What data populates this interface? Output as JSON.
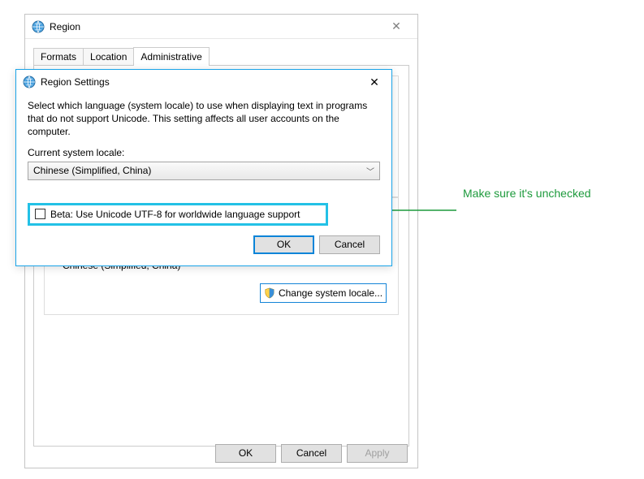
{
  "parent": {
    "title": "Region",
    "tabs": {
      "formats": "Formats",
      "location": "Location",
      "administrative": "Administrative"
    },
    "locale_readout": "Chinese (Simplified, China)",
    "change_locale_label": "Change system locale...",
    "buttons": {
      "ok": "OK",
      "cancel": "Cancel",
      "apply": "Apply"
    }
  },
  "child": {
    "title": "Region Settings",
    "description": "Select which language (system locale) to use when displaying text in programs that do not support Unicode. This setting affects all user accounts on the computer.",
    "locale_label": "Current system locale:",
    "locale_value": "Chinese (Simplified, China)",
    "beta_label": "Beta: Use Unicode UTF-8 for worldwide language support",
    "beta_checked": false,
    "buttons": {
      "ok": "OK",
      "cancel": "Cancel"
    }
  },
  "annotation": {
    "text": "Make sure it's unchecked",
    "color": "#1d9a3c"
  }
}
